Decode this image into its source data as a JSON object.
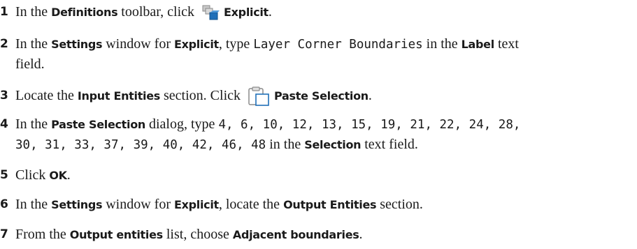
{
  "steps": [
    {
      "number": "1",
      "parts": [
        "In the",
        "Definitions",
        "toolbar, click",
        "Explicit",
        "."
      ],
      "icon": "explicit-selection-icon"
    },
    {
      "number": "2",
      "parts": [
        "In the",
        "Settings",
        "window for",
        "Explicit",
        ", type",
        "Layer Corner Boundaries",
        "in the",
        "Label",
        "text"
      ],
      "line2": "field."
    },
    {
      "number": "3",
      "parts": [
        "Locate the",
        "Input Entities",
        "section. Click",
        "Paste Selection",
        "."
      ],
      "icon": "paste-selection-icon"
    },
    {
      "number": "4",
      "parts": [
        "In the",
        "Paste Selection",
        "dialog, type",
        "4, 6, 10, 12, 13, 15, 19, 21, 22, 24, 28,"
      ],
      "line2_parts": [
        "30, 31, 33, 37, 39, 40, 42, 46, 48",
        "in the",
        "Selection",
        "text field."
      ]
    },
    {
      "number": "5",
      "parts": [
        "Click",
        "OK",
        "."
      ]
    },
    {
      "number": "6",
      "parts": [
        "In the",
        "Settings",
        "window for",
        "Explicit",
        ", locate the",
        "Output Entities",
        "section."
      ]
    },
    {
      "number": "7",
      "parts": [
        "From the",
        "Output entities",
        "list, choose",
        "Adjacent boundaries",
        "."
      ]
    }
  ],
  "colors": {
    "text": "#1a1a1a",
    "icon_blue": "#1f6fb8",
    "icon_gray": "#8a8a8a"
  }
}
